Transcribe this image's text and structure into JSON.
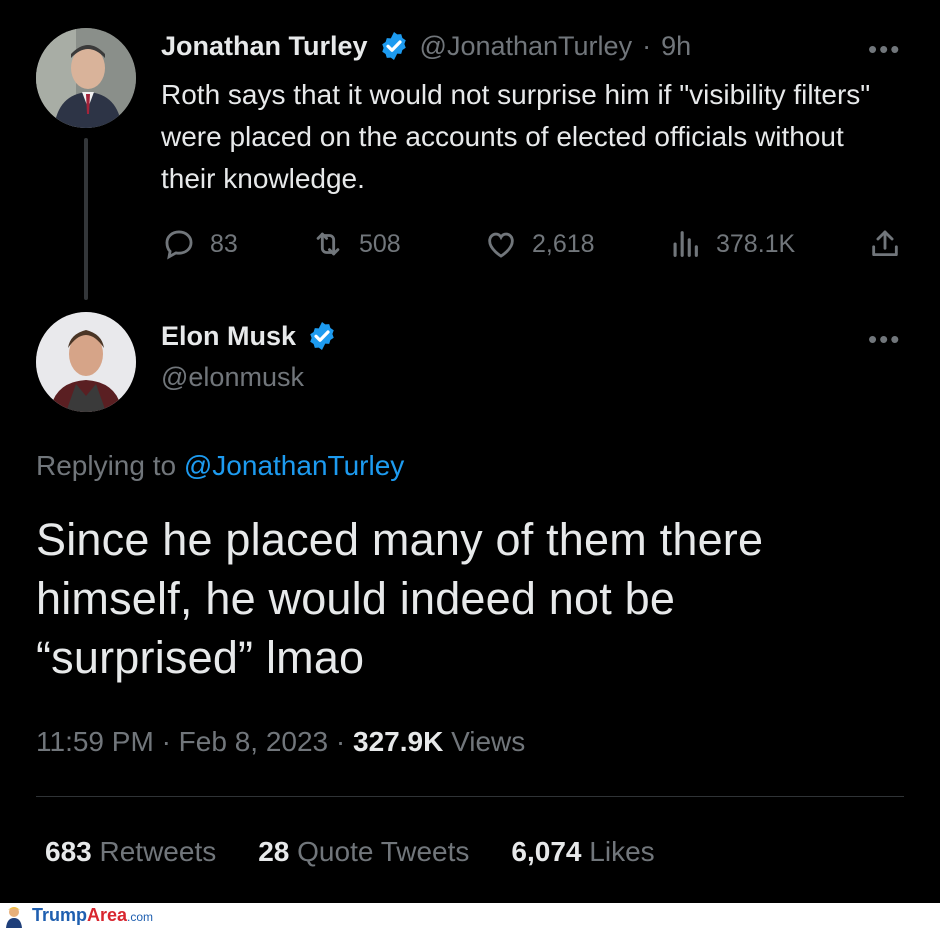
{
  "tweet1": {
    "name": "Jonathan Turley",
    "handle": "@JonathanTurley",
    "time": "9h",
    "text": "Roth says that it would not surprise him if \"visibility filters\" were placed on the accounts of elected officials without their knowledge.",
    "replies": "83",
    "retweets": "508",
    "likes": "2,618",
    "views": "378.1K"
  },
  "tweet2": {
    "name": "Elon Musk",
    "handle": "@elonmusk",
    "replying_label": "Replying to",
    "replying_to": "@JonathanTurley",
    "text_line1": "Since he placed many of them there",
    "text_line2": "himself, he would indeed not be",
    "text_line3": "“surprised” lmao",
    "time": "11:59 PM",
    "date": "Feb 8, 2023",
    "views_count": "327.9K",
    "views_label": "Views",
    "retweets_count": "683",
    "retweets_label": "Retweets",
    "quotes_count": "28",
    "quotes_label": "Quote Tweets",
    "likes_count": "6,074",
    "likes_label": "Likes"
  },
  "watermark": {
    "brand_part1": "Trump",
    "brand_part2": "Area",
    "brand_suffix": ".com"
  },
  "colors": {
    "background": "#000000",
    "text": "#e7e9ea",
    "secondary": "#71767b",
    "accent": "#1d9bf0"
  },
  "icons": [
    "verified-badge-icon",
    "more-icon",
    "reply-icon",
    "retweet-icon",
    "like-icon",
    "views-icon",
    "share-icon"
  ]
}
